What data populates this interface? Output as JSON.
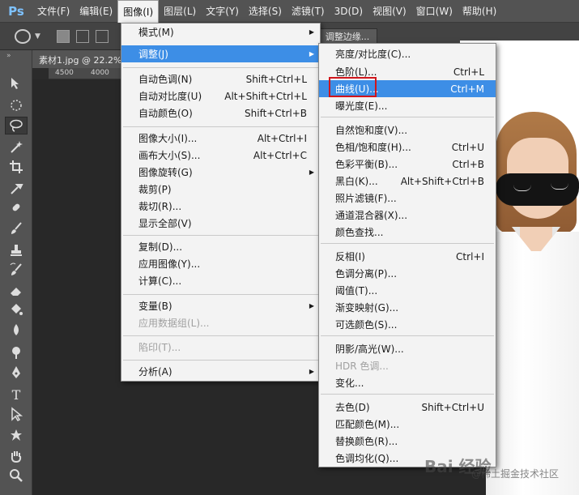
{
  "app": {
    "logo": "Ps"
  },
  "menubar": [
    {
      "label": "文件(F)",
      "active": false
    },
    {
      "label": "编辑(E)",
      "active": false
    },
    {
      "label": "图像(I)",
      "active": true
    },
    {
      "label": "图层(L)",
      "active": false
    },
    {
      "label": "文字(Y)",
      "active": false
    },
    {
      "label": "选择(S)",
      "active": false
    },
    {
      "label": "滤镜(T)",
      "active": false
    },
    {
      "label": "3D(D)",
      "active": false
    },
    {
      "label": "视图(V)",
      "active": false
    },
    {
      "label": "窗口(W)",
      "active": false
    },
    {
      "label": "帮助(H)",
      "active": false
    }
  ],
  "optionsbar": {
    "refine_edge_label": "调整边缘..."
  },
  "document": {
    "tab_label": "素材1.jpg @ 22.2%",
    "ruler_labels": [
      "4500",
      "4000"
    ]
  },
  "toolbar": {
    "collapse_glyph": "»",
    "tools": [
      {
        "icon": "move-tool-icon"
      },
      {
        "icon": "marquee-tool-icon"
      },
      {
        "icon": "lasso-tool-icon",
        "selected": true
      },
      {
        "icon": "magic-wand-tool-icon"
      },
      {
        "icon": "crop-tool-icon"
      },
      {
        "icon": "eyedropper-tool-icon"
      },
      {
        "icon": "healing-brush-tool-icon"
      },
      {
        "icon": "brush-tool-icon"
      },
      {
        "icon": "clone-stamp-tool-icon"
      },
      {
        "icon": "history-brush-tool-icon"
      },
      {
        "icon": "eraser-tool-icon"
      },
      {
        "icon": "paint-bucket-tool-icon"
      },
      {
        "icon": "blur-tool-icon"
      },
      {
        "icon": "dodge-tool-icon"
      },
      {
        "icon": "pen-tool-icon"
      },
      {
        "icon": "type-tool-icon",
        "glyph": "T"
      },
      {
        "icon": "path-selection-tool-icon"
      },
      {
        "icon": "custom-shape-tool-icon"
      },
      {
        "icon": "hand-tool-icon"
      },
      {
        "icon": "zoom-tool-icon"
      }
    ]
  },
  "image_menu": {
    "items": [
      {
        "label": "模式(M)",
        "submenu": true
      },
      {
        "label": "调整(J)",
        "submenu": true,
        "highlighted": true
      },
      {
        "label": "自动色调(N)",
        "shortcut": "Shift+Ctrl+L"
      },
      {
        "label": "自动对比度(U)",
        "shortcut": "Alt+Shift+Ctrl+L"
      },
      {
        "label": "自动颜色(O)",
        "shortcut": "Shift+Ctrl+B"
      },
      {
        "label": "图像大小(I)...",
        "shortcut": "Alt+Ctrl+I"
      },
      {
        "label": "画布大小(S)...",
        "shortcut": "Alt+Ctrl+C"
      },
      {
        "label": "图像旋转(G)",
        "submenu": true
      },
      {
        "label": "裁剪(P)"
      },
      {
        "label": "裁切(R)..."
      },
      {
        "label": "显示全部(V)"
      },
      {
        "label": "复制(D)..."
      },
      {
        "label": "应用图像(Y)..."
      },
      {
        "label": "计算(C)..."
      },
      {
        "label": "变量(B)",
        "submenu": true
      },
      {
        "label": "应用数据组(L)...",
        "disabled": true
      },
      {
        "label": "陷印(T)...",
        "disabled": true
      },
      {
        "label": "分析(A)",
        "submenu": true
      }
    ]
  },
  "adjust_menu": {
    "items": [
      {
        "label": "亮度/对比度(C)..."
      },
      {
        "label": "色阶(L)...",
        "shortcut": "Ctrl+L"
      },
      {
        "label": "曲线(U)...",
        "shortcut": "Ctrl+M",
        "highlighted": true
      },
      {
        "label": "曝光度(E)..."
      },
      {
        "label": "自然饱和度(V)..."
      },
      {
        "label": "色相/饱和度(H)...",
        "shortcut": "Ctrl+U"
      },
      {
        "label": "色彩平衡(B)...",
        "shortcut": "Ctrl+B"
      },
      {
        "label": "黑白(K)...",
        "shortcut": "Alt+Shift+Ctrl+B"
      },
      {
        "label": "照片滤镜(F)..."
      },
      {
        "label": "通道混合器(X)..."
      },
      {
        "label": "颜色查找..."
      },
      {
        "label": "反相(I)",
        "shortcut": "Ctrl+I"
      },
      {
        "label": "色调分离(P)..."
      },
      {
        "label": "阈值(T)..."
      },
      {
        "label": "渐变映射(G)..."
      },
      {
        "label": "可选颜色(S)..."
      },
      {
        "label": "阴影/高光(W)..."
      },
      {
        "label": "HDR 色调...",
        "disabled": true
      },
      {
        "label": "变化..."
      },
      {
        "label": "去色(D)",
        "shortcut": "Shift+Ctrl+U"
      },
      {
        "label": "匹配颜色(M)..."
      },
      {
        "label": "替换颜色(R)..."
      },
      {
        "label": "色调均化(Q)..."
      }
    ]
  },
  "watermark": {
    "main": "Bai 经验",
    "sub": "@稀土掘金技术社区"
  },
  "colors": {
    "highlight": "#3d8ee6",
    "annotation_box": "#d0161c",
    "menu_bg": "#f3f3f3",
    "ui_dark": "#535353"
  }
}
